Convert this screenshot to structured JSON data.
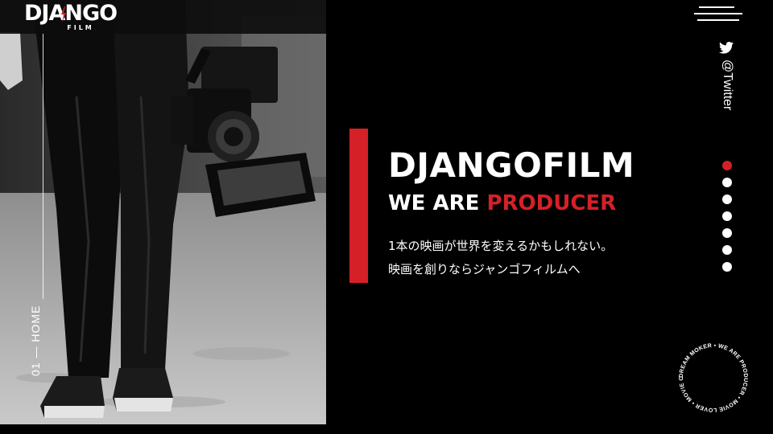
{
  "brand": {
    "logo_main": "DJANGO",
    "logo_sub": "FILM"
  },
  "page_indicator": "01 — HOME",
  "nav": {
    "menu_icon": "hamburger-menu-icon",
    "twitter_icon": "twitter-bird-icon",
    "twitter_label": "@Twitter"
  },
  "hero": {
    "title": "DJANGOFILM",
    "subtitle_plain": "WE ARE",
    "subtitle_accent": "PRODUCER",
    "tagline_line1": "1本の映画が世界を変えるかもしれない。",
    "tagline_line2": "映画を創りならジャンゴフィルムへ"
  },
  "slider": {
    "count": 7,
    "active_index": 0
  },
  "badge": {
    "ring_text": "DREAM MOKER • WE ARE PRODUCER • MOVIE LOVER • MOVIE CREATER •"
  },
  "colors": {
    "accent": "#d62027",
    "background": "#000000",
    "text": "#ffffff"
  }
}
